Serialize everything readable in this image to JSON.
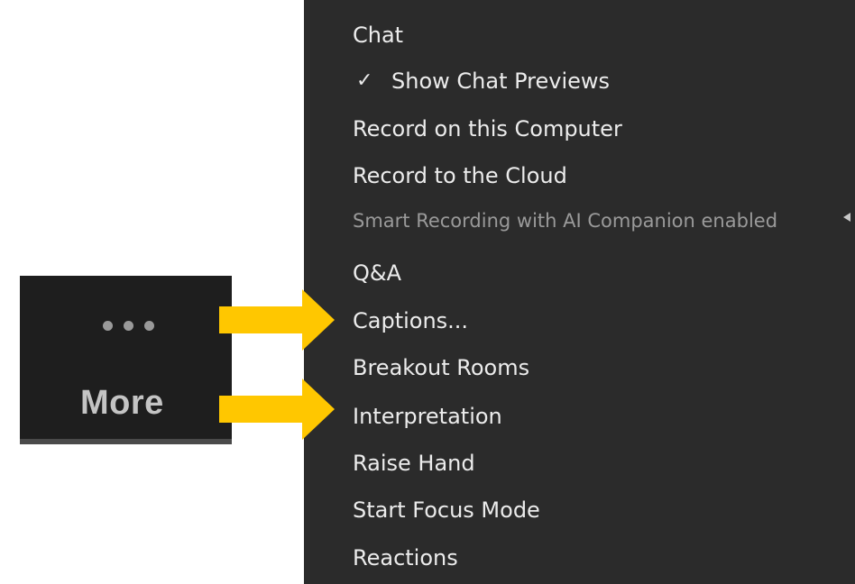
{
  "more_button": {
    "dots_icon": "more-dots-icon",
    "label": "More"
  },
  "menu": {
    "items": [
      {
        "label": "Chat",
        "checked": false,
        "enabled": true
      },
      {
        "label": "Show Chat Previews",
        "checked": true,
        "enabled": true
      },
      {
        "label": "Record on this Computer",
        "checked": false,
        "enabled": true
      },
      {
        "label": "Record to the Cloud",
        "checked": false,
        "enabled": true
      },
      {
        "label": "Smart Recording with AI Companion enabled",
        "checked": false,
        "enabled": false,
        "has_submenu": true
      },
      {
        "label": "Q&A",
        "checked": false,
        "enabled": true
      },
      {
        "label": "Captions...",
        "checked": false,
        "enabled": true
      },
      {
        "label": "Breakout Rooms",
        "checked": false,
        "enabled": true
      },
      {
        "label": "Interpretation",
        "checked": false,
        "enabled": true
      },
      {
        "label": "Raise Hand",
        "checked": false,
        "enabled": true
      },
      {
        "label": "Start Focus Mode",
        "checked": false,
        "enabled": true
      },
      {
        "label": "Reactions",
        "checked": false,
        "enabled": true
      }
    ],
    "check_glyph": "✓"
  },
  "annotations": {
    "arrow_color": "#ffc700",
    "arrow_targets": [
      "Captions...",
      "Interpretation"
    ]
  },
  "colors": {
    "menu_bg": "#2b2b2b",
    "button_bg": "#1e1e1e",
    "text": "#ececec",
    "disabled_text": "#9a9a9a"
  }
}
